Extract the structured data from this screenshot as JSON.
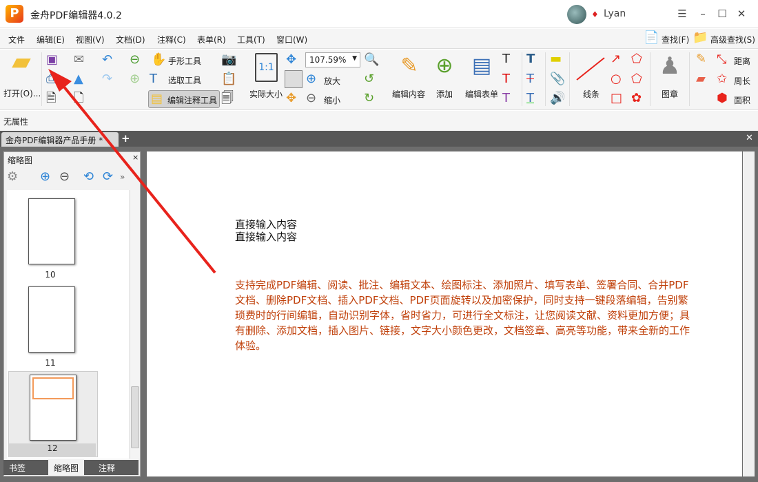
{
  "window": {
    "title": "金舟PDF编辑器4.0.2",
    "user": "Lyan",
    "logo_letter": "P"
  },
  "menu": [
    "文件",
    "编辑(E)",
    "视图(V)",
    "文档(D)",
    "注释(C)",
    "表单(R)",
    "工具(T)",
    "窗口(W)"
  ],
  "search": {
    "find": "查找(F)",
    "advanced_find": "高级查找(S)"
  },
  "toolbar": {
    "open": "打开(O)...",
    "hand_tool": "手形工具",
    "select_tool": "选取工具",
    "edit_annot_tool": "编辑注释工具",
    "actual_size": "实际大小",
    "zoom_value": "107.59%",
    "zoom_in": "放大",
    "zoom_out": "缩小",
    "edit_content": "编辑内容",
    "add": "添加",
    "edit_form": "编辑表单",
    "lines": "线条",
    "stamp": "图章",
    "distance": "距离",
    "perimeter": "周长",
    "area": "面积",
    "actual_size_icon": "1:1"
  },
  "properties": "无属性",
  "doc_tab": "金舟PDF编辑器产品手册 *",
  "panel": {
    "title": "缩略图",
    "thumbs": [
      "10",
      "11",
      "12"
    ],
    "bottom_tabs": [
      "书签",
      "缩略图",
      "注释"
    ]
  },
  "document": {
    "line1": "直接输入内容",
    "line2": "直接输入内容",
    "paragraph": "支持完成PDF编辑、阅读、批注、编辑文本、绘图标注、添加照片、填写表单、签署合同、合并PDF文档、删除PDF文档、插入PDF文档、PDF页面旋转以及加密保护，同时支持一键段落编辑，告别繁琐费时的行间编辑，自动识别字体，省时省力，可进行全文标注，让您阅读文献、资料更加方便；具有删除、添加文档，插入图片、链接，文字大小颜色更改，文档签章、高亮等功能，带来全新的工作体验。"
  },
  "colors": {
    "paragraph": "#c0400a",
    "arrow": "#e8231c",
    "selected_thumb_border": "#f39a5a"
  }
}
